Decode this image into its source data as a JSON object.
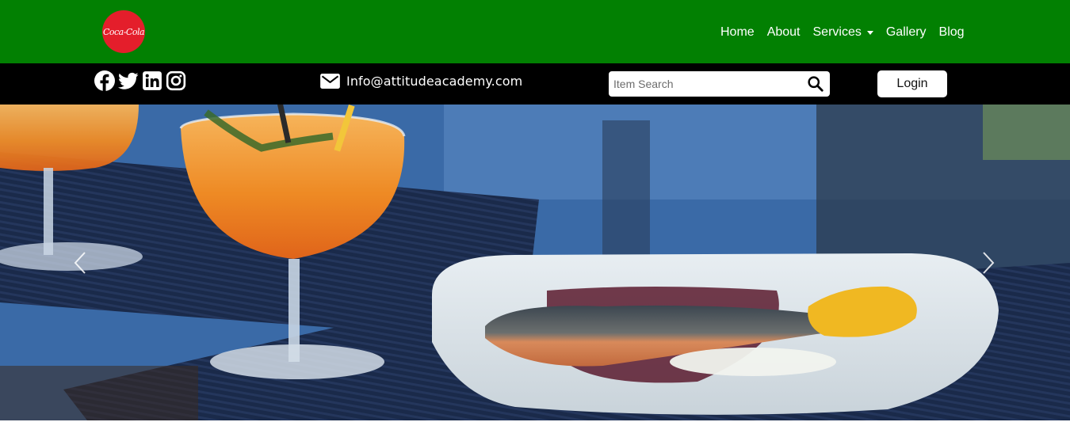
{
  "brand": {
    "logo_text": "Coca-Cola",
    "logo_color": "#e41e2b"
  },
  "nav": {
    "background": "#028002",
    "items": [
      {
        "label": "Home"
      },
      {
        "label": "About"
      },
      {
        "label": "Services",
        "dropdown": true
      },
      {
        "label": "Gallery"
      },
      {
        "label": "Blog"
      }
    ]
  },
  "infobar": {
    "background": "#000000",
    "social": [
      "facebook-icon",
      "twitter-icon",
      "linkedin-icon",
      "instagram-icon"
    ],
    "email": "Info@attitudeacademy.com",
    "search": {
      "placeholder": "Item Search",
      "value": ""
    },
    "login_label": "Login"
  },
  "hero": {
    "controls": {
      "prev": "chevron-left-icon",
      "next": "chevron-right-icon"
    }
  }
}
